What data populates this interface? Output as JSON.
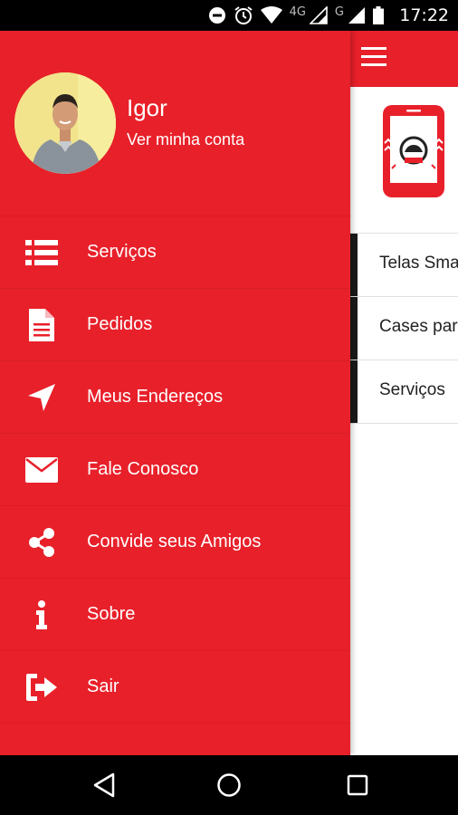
{
  "status_bar": {
    "time": "17:22",
    "network_label_1": "4G",
    "network_label_2": "G",
    "icons": [
      "do-not-disturb-icon",
      "alarm-icon",
      "wifi-icon",
      "signal-icon",
      "signal-icon",
      "battery-icon"
    ]
  },
  "drawer": {
    "user": {
      "name": "Igor",
      "account_link": "Ver minha conta"
    },
    "menu": [
      {
        "label": "Serviços",
        "icon": "list-icon"
      },
      {
        "label": "Pedidos",
        "icon": "document-icon"
      },
      {
        "label": "Meus Endereços",
        "icon": "location-arrow-icon"
      },
      {
        "label": "Fale Conosco",
        "icon": "envelope-icon"
      },
      {
        "label": "Convide seus Amigos",
        "icon": "share-icon"
      },
      {
        "label": "Sobre",
        "icon": "info-icon"
      },
      {
        "label": "Sair",
        "icon": "sign-out-icon"
      }
    ]
  },
  "background_app": {
    "list": [
      {
        "label": "Telas Sma"
      },
      {
        "label": "Cases par"
      },
      {
        "label": "Serviços"
      }
    ]
  },
  "colors": {
    "accent": "#e8202a",
    "text_on_accent": "#ffffff",
    "status_bar": "#000000"
  }
}
